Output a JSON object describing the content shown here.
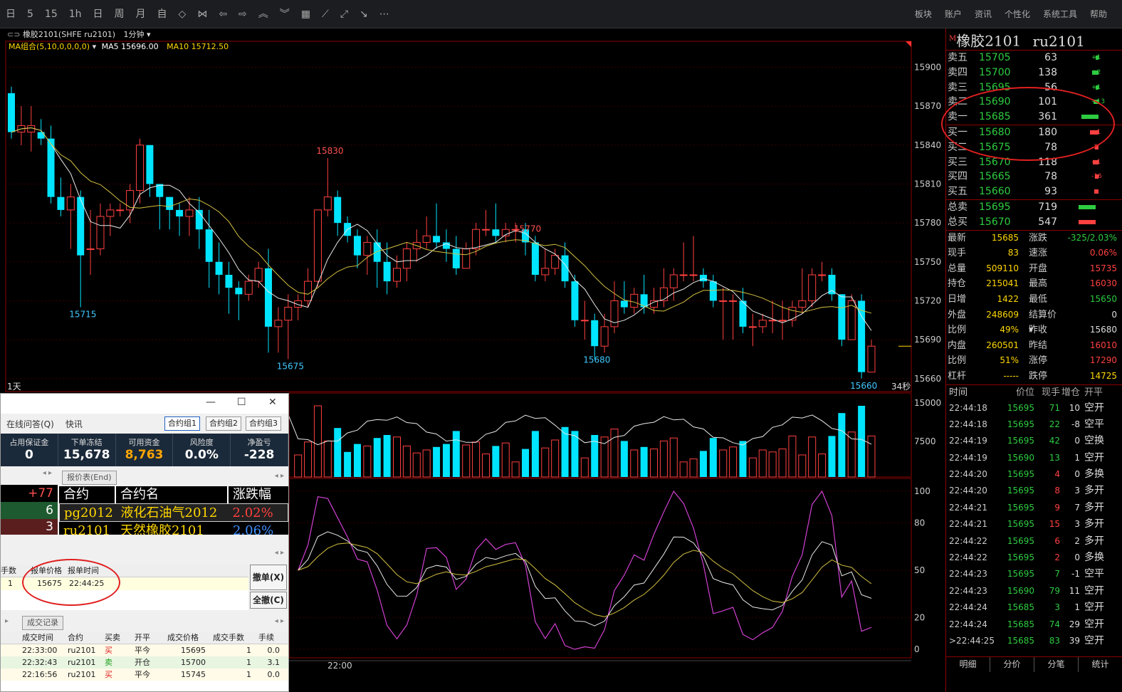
{
  "toolbar": {
    "left_items": [
      "日",
      "5",
      "15",
      "1h",
      "日",
      "周",
      "月",
      "自"
    ],
    "right_items": [
      "板块",
      "账户",
      "资讯",
      "个性化",
      "系统工具",
      "帮助"
    ]
  },
  "chart": {
    "title": "橡胶2101(SHFE ru2101)",
    "period": "1分钟",
    "ma_group": "MA组合(5,10,0,0,0,0)",
    "ma5": "MA5 15696.00",
    "ma10": "MA10 15712.50",
    "corner_left": "1天",
    "corner_right": "34秒",
    "time_label": "22:00",
    "y_axis": [
      "15900",
      "15870",
      "15840",
      "15810",
      "15780",
      "15750",
      "15720",
      "15690",
      "15660"
    ],
    "vol_axis": [
      "15000",
      "7500"
    ],
    "kdj_axis": [
      "100",
      "80",
      "50",
      "20",
      "0"
    ],
    "annotations": {
      "p15830": "15830",
      "p15770": "15770",
      "p15715": "15715",
      "p15675": "15675",
      "p15680": "15680",
      "p15660": "15660"
    }
  },
  "quote": {
    "title": "橡胶2101",
    "code": "ru2101",
    "asks": [
      {
        "label": "卖五",
        "price": "15705",
        "vol": "63",
        "chg": "+1"
      },
      {
        "label": "卖四",
        "price": "15700",
        "vol": "138",
        "chg": "+2"
      },
      {
        "label": "卖三",
        "price": "15695",
        "vol": "56",
        "chg": "+1"
      },
      {
        "label": "卖二",
        "price": "15690",
        "vol": "101",
        "chg": "+13"
      },
      {
        "label": "卖一",
        "price": "15685",
        "vol": "361",
        "chg": ""
      }
    ],
    "bids": [
      {
        "label": "买一",
        "price": "15680",
        "vol": "180",
        "chg": "+1"
      },
      {
        "label": "买二",
        "price": "15675",
        "vol": "78",
        "chg": "-3"
      },
      {
        "label": "买三",
        "price": "15670",
        "vol": "118",
        "chg": "+1"
      },
      {
        "label": "买四",
        "price": "15665",
        "vol": "78",
        "chg": "-16"
      },
      {
        "label": "买五",
        "price": "15660",
        "vol": "93",
        "chg": ""
      }
    ],
    "totals": [
      {
        "label": "总卖",
        "price": "15695",
        "vol": "719"
      },
      {
        "label": "总买",
        "price": "15670",
        "vol": "547"
      }
    ],
    "stats": [
      {
        "k1": "最新",
        "v1": "15685",
        "k2": "涨跌",
        "v2": "-325/2.03%"
      },
      {
        "k1": "现手",
        "v1": "83",
        "k2": "速涨",
        "v2": "0.06%"
      },
      {
        "k1": "总量",
        "v1": "509110",
        "k2": "开盘",
        "v2": "15735"
      },
      {
        "k1": "持仓",
        "v1": "215041",
        "k2": "最高",
        "v2": "16030"
      },
      {
        "k1": "日增",
        "v1": "1422",
        "k2": "最低",
        "v2": "15650"
      },
      {
        "k1": "外盘",
        "v1": "248609",
        "k2": "结算价▾",
        "v2": "0"
      },
      {
        "k1": "比例",
        "v1": "49%",
        "k2": "昨收",
        "v2": "15680"
      },
      {
        "k1": "内盘",
        "v1": "260501",
        "k2": "昨结",
        "v2": "16010"
      },
      {
        "k1": "比例",
        "v1": "51%",
        "k2": "涨停",
        "v2": "17290"
      },
      {
        "k1": "杠杆",
        "v1": "-----",
        "k2": "跌停",
        "v2": "14725"
      }
    ],
    "tick_headers": [
      "时间",
      "价位",
      "现手",
      "增仓",
      "开平"
    ],
    "ticks": [
      [
        "22:44:18",
        "15695",
        "71",
        "10",
        "空开"
      ],
      [
        "22:44:18",
        "15695",
        "22",
        "-8",
        "空平"
      ],
      [
        "22:44:19",
        "15695",
        "42",
        "0",
        "空换"
      ],
      [
        "22:44:19",
        "15690",
        "13",
        "1",
        "空开"
      ],
      [
        "22:44:20",
        "15695",
        "4",
        "0",
        "多换"
      ],
      [
        "22:44:20",
        "15695",
        "8",
        "3",
        "多开"
      ],
      [
        "22:44:21",
        "15695",
        "9",
        "7",
        "多开"
      ],
      [
        "22:44:21",
        "15695",
        "15",
        "3",
        "多开"
      ],
      [
        "22:44:22",
        "15695",
        "6",
        "2",
        "多开"
      ],
      [
        "22:44:22",
        "15695",
        "2",
        "0",
        "多换"
      ],
      [
        "22:44:23",
        "15695",
        "7",
        "-1",
        "空平"
      ],
      [
        "22:44:23",
        "15690",
        "79",
        "11",
        "空开"
      ],
      [
        "22:44:24",
        "15685",
        "3",
        "1",
        "空开"
      ],
      [
        "22:44:24",
        "15685",
        "74",
        "29",
        "空开"
      ],
      [
        ">22:44:25",
        "15685",
        "83",
        "39",
        "空开"
      ]
    ],
    "tabs": [
      "明细",
      "分价",
      "分笔",
      "统计"
    ]
  },
  "dialog": {
    "menu": [
      "在线问答(Q)",
      "快讯"
    ],
    "groups": [
      "合约组1",
      "合约组2",
      "合约组3"
    ],
    "account": [
      {
        "label": "占用保证金",
        "value": "0"
      },
      {
        "label": "下单冻结",
        "value": "15,678"
      },
      {
        "label": "可用资金",
        "value": "8,763"
      },
      {
        "label": "风险度",
        "value": "0.0%"
      },
      {
        "label": "净盈亏",
        "value": "-228"
      }
    ],
    "left_values": [
      "+77",
      "6",
      "3"
    ],
    "quote_tab": "报价表(End)",
    "quote_headers": [
      "合约",
      "合约名",
      "涨跌幅"
    ],
    "quote_rows": [
      [
        "pg2012",
        "液化石油气2012",
        "2.02%"
      ],
      [
        "ru2101",
        "天然橡胶2101",
        "2.06%"
      ]
    ],
    "order_headers": [
      "手数",
      "报单价格",
      "报单时间"
    ],
    "order_row": [
      "1",
      "15675",
      "22:44:25"
    ],
    "cancel_btn": "撤单(X)",
    "cancel_all_btn": "全撤(C)",
    "trades_tab": "成交记录",
    "trade_headers": [
      "成交时间",
      "合约",
      "买卖",
      "开平",
      "成交价格",
      "成交手数",
      "手续"
    ],
    "trades": [
      [
        "22:33:00",
        "ru2101",
        "买",
        "平今",
        "15695",
        "1",
        "0.0"
      ],
      [
        "22:32:43",
        "ru2101",
        "卖",
        "开仓",
        "15700",
        "1",
        "3.1"
      ],
      [
        "22:16:56",
        "ru2101",
        "买",
        "平今",
        "15745",
        "1",
        "0.0"
      ]
    ]
  },
  "chart_data": {
    "type": "candlestick",
    "ylim": [
      15650,
      15920
    ],
    "candles": [
      [
        15880,
        15850,
        15885,
        15845
      ],
      [
        15850,
        15855,
        15870,
        15840
      ],
      [
        15850,
        15855,
        15870,
        15835
      ],
      [
        15850,
        15845,
        15860,
        15840
      ],
      [
        15845,
        15800,
        15855,
        15795
      ],
      [
        15800,
        15790,
        15815,
        15785
      ],
      [
        15790,
        15800,
        15810,
        15760
      ],
      [
        15800,
        15755,
        15805,
        15715
      ],
      [
        15760,
        15760,
        15790,
        15740
      ],
      [
        15760,
        15785,
        15795,
        15755
      ],
      [
        15785,
        15790,
        15795,
        15770
      ],
      [
        15790,
        15790,
        15795,
        15785
      ],
      [
        15790,
        15805,
        15810,
        15780
      ],
      [
        15805,
        15840,
        15845,
        15795
      ],
      [
        15840,
        15810,
        15840,
        15800
      ],
      [
        15810,
        15800,
        15805,
        15775
      ],
      [
        15800,
        15790,
        15800,
        15775
      ],
      [
        15790,
        15785,
        15795,
        15770
      ],
      [
        15785,
        15790,
        15800,
        15770
      ],
      [
        15790,
        15775,
        15800,
        15760
      ],
      [
        15775,
        15750,
        15790,
        15730
      ],
      [
        15750,
        15740,
        15765,
        15725
      ],
      [
        15740,
        15730,
        15750,
        15710
      ],
      [
        15730,
        15725,
        15735,
        15705
      ],
      [
        15725,
        15735,
        15740,
        15720
      ],
      [
        15735,
        15745,
        15750,
        15730
      ],
      [
        15745,
        15700,
        15760,
        15680
      ],
      [
        15700,
        15705,
        15715,
        15680
      ],
      [
        15705,
        15715,
        15725,
        15675
      ],
      [
        15715,
        15720,
        15725,
        15705
      ],
      [
        15720,
        15735,
        15745,
        15715
      ],
      [
        15735,
        15790,
        15790,
        15730
      ],
      [
        15790,
        15800,
        15830,
        15785
      ],
      [
        15800,
        15780,
        15805,
        15770
      ],
      [
        15780,
        15770,
        15785,
        15765
      ],
      [
        15770,
        15755,
        15775,
        15745
      ],
      [
        15755,
        15765,
        15770,
        15740
      ],
      [
        15765,
        15750,
        15775,
        15730
      ],
      [
        15750,
        15735,
        15765,
        15725
      ],
      [
        15735,
        15745,
        15755,
        15730
      ],
      [
        15745,
        15760,
        15765,
        15735
      ],
      [
        15760,
        15765,
        15775,
        15750
      ],
      [
        15765,
        15770,
        15785,
        15760
      ],
      [
        15770,
        15765,
        15795,
        15760
      ],
      [
        15765,
        15760,
        15775,
        15750
      ],
      [
        15760,
        15745,
        15770,
        15740
      ],
      [
        15745,
        15760,
        15765,
        15745
      ],
      [
        15760,
        15775,
        15780,
        15755
      ],
      [
        15775,
        15775,
        15790,
        15770
      ],
      [
        15775,
        15770,
        15795,
        15765
      ],
      [
        15770,
        15775,
        15780,
        15765
      ],
      [
        15775,
        15775,
        15780,
        15765
      ],
      [
        15775,
        15765,
        15780,
        15755
      ],
      [
        15765,
        15740,
        15770,
        15735
      ],
      [
        15740,
        15745,
        15760,
        15735
      ],
      [
        15745,
        15755,
        15760,
        15740
      ],
      [
        15755,
        15735,
        15765,
        15730
      ],
      [
        15735,
        15705,
        15740,
        15700
      ],
      [
        15705,
        15705,
        15720,
        15690
      ],
      [
        15705,
        15685,
        15710,
        15675
      ],
      [
        15685,
        15700,
        15710,
        15680
      ],
      [
        15700,
        15720,
        15735,
        15695
      ],
      [
        15720,
        15715,
        15735,
        15710
      ],
      [
        15715,
        15725,
        15730,
        15710
      ],
      [
        15725,
        15715,
        15740,
        15710
      ],
      [
        15715,
        15720,
        15730,
        15710
      ],
      [
        15720,
        15730,
        15745,
        15715
      ],
      [
        15730,
        15740,
        15745,
        15720
      ],
      [
        15740,
        15740,
        15765,
        15735
      ],
      [
        15740,
        15740,
        15770,
        15735
      ],
      [
        15740,
        15735,
        15745,
        15730
      ],
      [
        15735,
        15720,
        15740,
        15715
      ],
      [
        15720,
        15720,
        15730,
        15690
      ],
      [
        15720,
        15720,
        15725,
        15690
      ],
      [
        15720,
        15700,
        15730,
        15695
      ],
      [
        15700,
        15700,
        15710,
        15685
      ],
      [
        15700,
        15705,
        15710,
        15695
      ],
      [
        15705,
        15705,
        15720,
        15695
      ],
      [
        15705,
        15705,
        15720,
        15690
      ],
      [
        15705,
        15715,
        15720,
        15700
      ],
      [
        15715,
        15720,
        15745,
        15710
      ],
      [
        15720,
        15740,
        15745,
        15715
      ],
      [
        15740,
        15740,
        15750,
        15735
      ],
      [
        15740,
        15725,
        15745,
        15720
      ],
      [
        15725,
        15690,
        15725,
        15685
      ],
      [
        15690,
        15720,
        15725,
        15690
      ],
      [
        15720,
        15665,
        15725,
        15660
      ],
      [
        15665,
        15685,
        15690,
        15685
      ]
    ]
  }
}
